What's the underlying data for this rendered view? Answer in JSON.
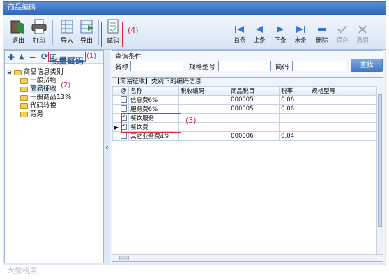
{
  "window": {
    "title": "商品编码"
  },
  "toolbar": {
    "exit_label": "退出",
    "print_label": "打印",
    "import_label": "导入",
    "export_label": "导出",
    "assign_label": "赋码",
    "nav": {
      "first_label": "首条",
      "prev_label": "上条",
      "next_label": "下条",
      "last_label": "末条",
      "delete_label": "删除",
      "save_label": "保存",
      "cancel_label": "撤销"
    }
  },
  "annotations": {
    "a1": "(1)",
    "a2": "(2)",
    "a3": "(3)",
    "a4": "(4)"
  },
  "left_panel": {
    "batch_assign_label": "批量赋码",
    "batch_assign_checked": true,
    "tree_root": "商品信息类别",
    "tree_items": [
      "一般货物",
      "简易征收",
      "一般商品13%",
      "代码转换",
      "劳务"
    ],
    "selected_item": "简易征收"
  },
  "query": {
    "group_label": "查询条件",
    "name_label": "名称",
    "name_value": "",
    "spec_label": "规格型号",
    "spec_value": "",
    "abbr_label": "简码",
    "abbr_value": "",
    "search_label": "查找"
  },
  "grid": {
    "title": "【简易征收】类别下的编码信息",
    "columns": [
      "@",
      "名称",
      "税收编码",
      "商品税目",
      "税率",
      "规格型号"
    ],
    "rows": [
      {
        "checked": false,
        "name": "信息费6%",
        "tax_code": "",
        "item": "000005",
        "rate": "0.06",
        "spec": ""
      },
      {
        "checked": false,
        "name": "服务费6%",
        "tax_code": "",
        "item": "000005",
        "rate": "0.06",
        "spec": ""
      },
      {
        "checked": true,
        "name": "餐饮服务",
        "tax_code": "",
        "item": "",
        "rate": "",
        "spec": ""
      },
      {
        "checked": true,
        "name": "餐饮费",
        "tax_code": "",
        "item": "",
        "rate": "",
        "spec": ""
      },
      {
        "checked": false,
        "name": "其它业务费4%",
        "tax_code": "",
        "item": "000006",
        "rate": "0.04",
        "spec": ""
      }
    ]
  },
  "watermark": "大象税务"
}
